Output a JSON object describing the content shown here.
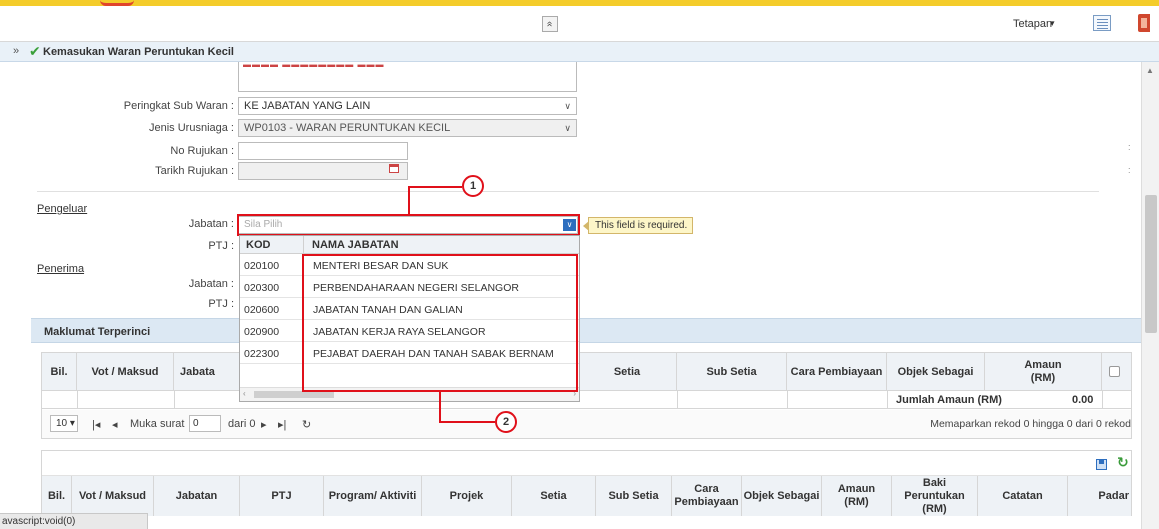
{
  "header": {
    "collapse_glyph": "»",
    "settings_label": "Tetapan",
    "settings_caret": "▾"
  },
  "title_bar": {
    "expand_glyph": "»",
    "title": "Kemasukan Waran Peruntukan Kecil"
  },
  "form": {
    "peringkat_label": "Peringkat Sub Waran :",
    "peringkat_value": "KE JABATAN YANG LAIN",
    "jenis_label": "Jenis Urusniaga :",
    "jenis_value": "WP0103 - WARAN PERUNTUKAN KECIL",
    "no_rujukan_label": "No Rujukan :",
    "tarikh_label": "Tarikh Rujukan :",
    "caret": "∨"
  },
  "pengeluar": {
    "section_label": "Pengeluar",
    "jabatan_label": "Jabatan :",
    "jabatan_placeholder": "Sila Pilih",
    "ptj_label": "PTJ :",
    "validation_message": "This field is required.",
    "dropdown_glyph": "∨"
  },
  "penerima": {
    "section_label": "Penerima",
    "jabatan_label": "Jabatan :",
    "ptj_label": "PTJ :"
  },
  "dropdown": {
    "col_kod": "KOD",
    "col_nama": "NAMA JABATAN",
    "rows": [
      {
        "kod": "020100",
        "nama": "MENTERI BESAR DAN SUK"
      },
      {
        "kod": "020300",
        "nama": "PERBENDAHARAAN NEGERI SELANGOR"
      },
      {
        "kod": "020600",
        "nama": "JABATAN TANAH DAN GALIAN"
      },
      {
        "kod": "020900",
        "nama": "JABATAN KERJA RAYA SELANGOR"
      },
      {
        "kod": "022300",
        "nama": "PEJABAT DAERAH DAN TANAH SABAK BERNAM"
      }
    ],
    "scroll_left": "‹",
    "scroll_right": "›"
  },
  "callouts": [
    "1",
    "2"
  ],
  "maklumat": {
    "title": "Maklumat Terperinci",
    "columns": [
      "Bil.",
      "Vot / Maksud",
      "Jabata",
      "Setia",
      "Sub Setia",
      "Cara Pembiayaan",
      "Objek Sebagai",
      "Amaun (RM)"
    ],
    "sum_label": "Jumlah Amaun (RM)",
    "sum_value": "0.00"
  },
  "pager": {
    "page_size": "10",
    "page_size_caret": "▾",
    "first": "|◂",
    "prev": "◂",
    "page_label": "Muka surat",
    "page_value": "0",
    "of_label": "dari 0",
    "next": "▸",
    "last": "▸|",
    "refresh": "↻",
    "info": "Memaparkan rekod 0 hingga 0 dari 0 rekod"
  },
  "grid2": {
    "columns": [
      "Bil.",
      "Vot / Maksud",
      "Jabatan",
      "PTJ",
      "Program/ Aktiviti",
      "Projek",
      "Setia",
      "Sub Setia",
      "Cara Pembiayaan",
      "Objek Sebagai",
      "Amaun (RM)",
      "Baki Peruntukan (RM)",
      "Catatan",
      "Padar"
    ],
    "refresh_glyph": "↻"
  },
  "status_bar": {
    "text": "avascript:void(0)"
  },
  "colors": {
    "accent_yellow": "#f4cc2a",
    "highlight_red": "#e0101a",
    "header_blue": "#dce8f3"
  }
}
